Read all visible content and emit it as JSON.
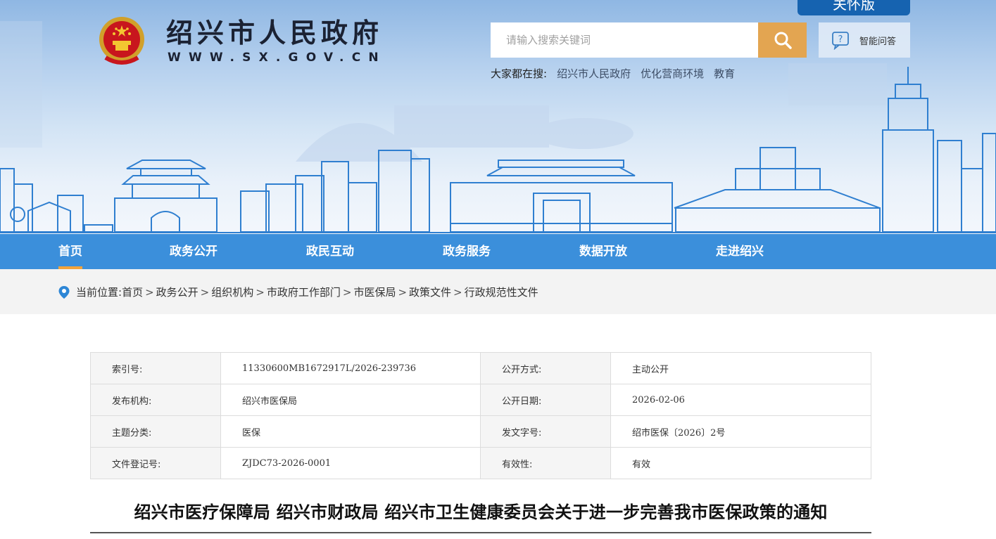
{
  "header": {
    "site_title": "绍兴市人民政府",
    "site_url": "WWW.SX.GOV.CN",
    "care_mode_label": "关怀版",
    "search_placeholder": "请输入搜索关键词",
    "ai_label": "智能问答",
    "hot_label": "大家都在搜:",
    "hot_keywords": [
      "绍兴市人民政府",
      "优化营商环境",
      "教育"
    ]
  },
  "nav": {
    "items": [
      "首页",
      "政务公开",
      "政民互动",
      "政务服务",
      "数据开放",
      "走进绍兴"
    ],
    "active_index": 0
  },
  "breadcrumb": {
    "label": "当前位置:",
    "items": [
      "首页",
      "政务公开",
      "组织机构",
      "市政府工作部门",
      "市医保局",
      "政策文件",
      "行政规范性文件"
    ],
    "separator": ">"
  },
  "info_table": {
    "rows": [
      {
        "k1": "索引号:",
        "v1": "11330600MB1672917L/2026-239736",
        "k2": "公开方式:",
        "v2": "主动公开"
      },
      {
        "k1": "发布机构:",
        "v1": "绍兴市医保局",
        "k2": "公开日期:",
        "v2": "2026-02-06"
      },
      {
        "k1": "主题分类:",
        "v1": "医保",
        "k2": "发文字号:",
        "v2": "绍市医保〔2026〕2号"
      },
      {
        "k1": "文件登记号:",
        "v1": "ZJDC73-2026-0001",
        "k2": "有效性:",
        "v2": "有效"
      }
    ]
  },
  "document": {
    "title": "绍兴市医疗保障局 绍兴市财政局 绍兴市卫生健康委员会关于进一步完善我市医保政策的通知"
  },
  "colors": {
    "nav_bg": "#3b8fdb",
    "nav_active_underline": "#f2a33a",
    "search_button": "#e3a551",
    "care_button": "#1663b0"
  },
  "icons": [
    "national-emblem",
    "search-icon",
    "ai-chat-icon",
    "location-pin-icon"
  ]
}
